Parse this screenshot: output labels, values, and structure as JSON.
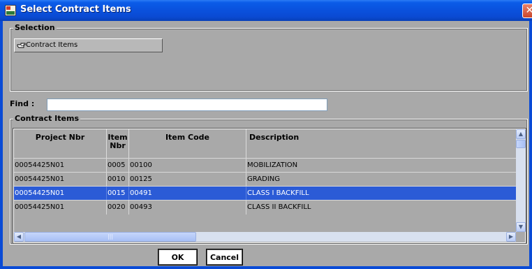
{
  "window": {
    "title": "Select Contract Items",
    "close_glyph": "✕"
  },
  "selection": {
    "group_label": "Selection",
    "button_label": "Contract Items",
    "button_icon": "pointing-hand-icon"
  },
  "find": {
    "label": "Find :",
    "value": ""
  },
  "contract_items": {
    "group_label": "Contract Items",
    "columns": [
      "Project Nbr",
      "Item Nbr",
      "Item Code",
      "Description"
    ],
    "rows": [
      {
        "project_nbr": "00054425N01",
        "item_nbr": "0005",
        "item_code": "00100",
        "description": "MOBILIZATION",
        "selected": false
      },
      {
        "project_nbr": "00054425N01",
        "item_nbr": "0010",
        "item_code": "00125",
        "description": "GRADING",
        "selected": false
      },
      {
        "project_nbr": "00054425N01",
        "item_nbr": "0015",
        "item_code": "00491",
        "description": "CLASS I BACKFILL",
        "selected": true
      },
      {
        "project_nbr": "00054425N01",
        "item_nbr": "0020",
        "item_code": "00493",
        "description": "CLASS II BACKFILL",
        "selected": false
      }
    ]
  },
  "buttons": {
    "ok": "OK",
    "cancel": "Cancel"
  },
  "colors": {
    "title_bar": "#0a52de",
    "selected_row": "#2b5bd6",
    "client_bg": "#a9a9a9"
  }
}
